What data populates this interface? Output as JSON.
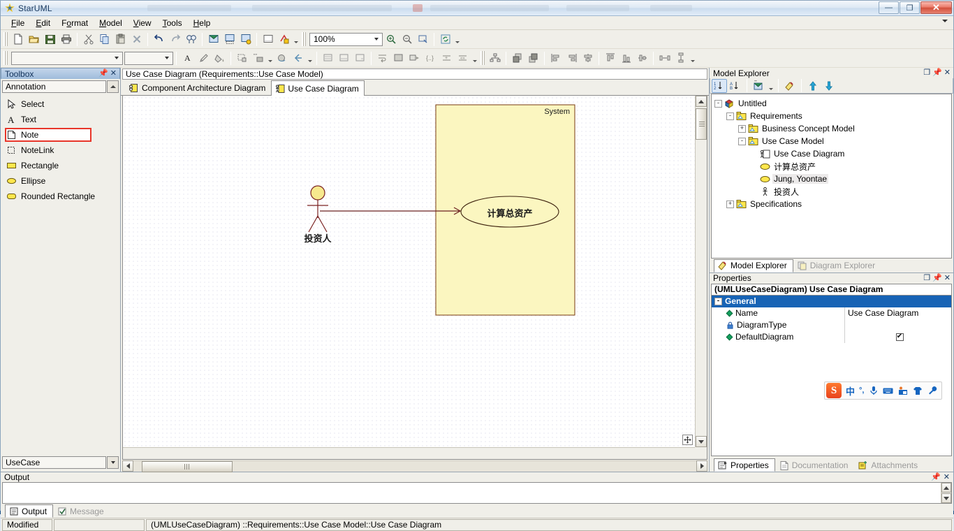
{
  "window": {
    "title": "StarUML",
    "app_icon": "star-icon",
    "minimize_label": "—",
    "maximize_label": "❐",
    "close_label": "✕"
  },
  "menubar": {
    "items": [
      {
        "label": "File",
        "mnemonic": "F"
      },
      {
        "label": "Edit",
        "mnemonic": "E"
      },
      {
        "label": "Format",
        "mnemonic": "o"
      },
      {
        "label": "Model",
        "mnemonic": "M"
      },
      {
        "label": "View",
        "mnemonic": "V"
      },
      {
        "label": "Tools",
        "mnemonic": "T"
      },
      {
        "label": "Help",
        "mnemonic": "H"
      }
    ],
    "overflow_icon": "chevron-down-icon"
  },
  "toolbar_main": {
    "zoom_value": "100%",
    "groups": [
      {
        "name": "file",
        "buttons": [
          "new-file-icon",
          "open-folder-icon",
          "save-icon",
          "print-icon"
        ]
      },
      {
        "name": "clipboard",
        "buttons": [
          "cut-icon",
          "copy-icon",
          "paste-icon",
          "delete-icon"
        ]
      },
      {
        "name": "history",
        "buttons": [
          "undo-icon",
          "redo-icon",
          "find-icon"
        ]
      },
      {
        "name": "diagram",
        "buttons": [
          "add-diagram-icon",
          "add-subdiagram-icon",
          "diagram-props-icon"
        ]
      },
      {
        "name": "generate",
        "buttons": [
          "generate-doc-icon",
          "validate-icon"
        ]
      },
      {
        "name": "zoom",
        "buttons": [
          "zoom-in-icon",
          "zoom-out-icon",
          "fit-window-icon"
        ]
      },
      {
        "name": "refresh",
        "buttons": [
          "refresh-icon"
        ]
      }
    ]
  },
  "toolbar_format": {
    "font_family_value": "",
    "font_size_value": "",
    "buttons": [
      "font-color-icon",
      "line-color-icon",
      "fill-color-icon",
      "stereotype-display-icon",
      "name-compartment-icon",
      "shadow-icon",
      "auto-resize-icon",
      "suppress-attributes-icon",
      "suppress-operations-icon",
      "suppress-literals-icon",
      "word-wrap-icon",
      "show-compartment-icon",
      "show-property-icon",
      "show-multiplicity-icon",
      "show-visibility-icon",
      "show-signature-icon",
      "layout-diagram-icon",
      "bring-to-front-icon",
      "send-to-back-icon",
      "align-left-icon",
      "align-center-icon",
      "align-right-icon",
      "align-top-icon",
      "align-middle-icon",
      "align-bottom-icon",
      "space-horizontally-icon",
      "space-vertically-icon"
    ]
  },
  "toolbox": {
    "title": "Toolbox",
    "pin_icon": "pin-icon",
    "close_icon": "close-icon",
    "group_label": "Annotation",
    "scroll_up_icon": "scroll-up-icon",
    "selected_item": "Note",
    "items": [
      {
        "label": "Select",
        "icon": "cursor-arrow-icon",
        "selected": false
      },
      {
        "label": "Text",
        "icon": "text-a-icon",
        "selected": false
      },
      {
        "label": "Note",
        "icon": "note-icon",
        "selected": true
      },
      {
        "label": "NoteLink",
        "icon": "note-link-icon",
        "selected": false
      },
      {
        "label": "Rectangle",
        "icon": "rectangle-icon",
        "selected": false
      },
      {
        "label": "Ellipse",
        "icon": "ellipse-icon",
        "selected": false
      },
      {
        "label": "Rounded Rectangle",
        "icon": "rounded-rectangle-icon",
        "selected": false
      }
    ],
    "bottom_group_label": "UseCase",
    "scroll_down_icon": "scroll-down-icon",
    "highlight_color": "#e8362a"
  },
  "editor": {
    "path": "Use Case Diagram (Requirements::Use Case Model)",
    "tabs": [
      {
        "label": "Component Architecture Diagram",
        "icon": "component-diagram-icon",
        "active": false
      },
      {
        "label": "Use Case Diagram",
        "icon": "usecase-diagram-icon",
        "active": true
      }
    ]
  },
  "diagram": {
    "type": "usecase",
    "boundary": {
      "label": "System",
      "fill": "#fbf6c0",
      "stroke": "#7a3b10"
    },
    "actor": {
      "label": "投资人",
      "head_fill": "#f7e98e",
      "stroke": "#7a2222"
    },
    "usecase": {
      "label": "计算总资产",
      "stroke": "#3b1f0b"
    },
    "association": {
      "from": "投资人",
      "to": "计算总资产",
      "stroke": "#6b2020"
    },
    "pan_icon": "pan-move-icon"
  },
  "model_explorer": {
    "title": "Model Explorer",
    "restore_icon": "restore-icon",
    "pin_icon": "pin-icon",
    "close_icon": "close-icon",
    "toolbar": [
      {
        "icon": "sort-numeric-icon",
        "active": true
      },
      {
        "icon": "sort-alpha-icon",
        "active": false
      },
      {
        "icon": "filter-diagram-icon",
        "active": false
      },
      {
        "icon": "select-in-explorer-icon",
        "active": false
      },
      {
        "icon": "move-up-icon",
        "active": false
      },
      {
        "icon": "move-down-icon",
        "active": false
      }
    ],
    "tree": [
      {
        "label": "Untitled",
        "depth": 0,
        "toggle": "-",
        "icon": "project-icon"
      },
      {
        "label": "Requirements",
        "depth": 1,
        "toggle": "-",
        "icon": "package-icon"
      },
      {
        "label": "Business Concept Model",
        "depth": 2,
        "toggle": "+",
        "icon": "package-icon"
      },
      {
        "label": "Use Case Model",
        "depth": 2,
        "toggle": "-",
        "icon": "package-icon"
      },
      {
        "label": "Use Case Diagram",
        "depth": 3,
        "toggle": "",
        "icon": "usecase-diagram-icon"
      },
      {
        "label": "计算总资产",
        "depth": 3,
        "toggle": "",
        "icon": "usecase-icon"
      },
      {
        "label": "Jung, Yoontae",
        "depth": 3,
        "toggle": "",
        "icon": "usecase-icon",
        "highlighted": true
      },
      {
        "label": "投资人",
        "depth": 3,
        "toggle": "",
        "icon": "actor-icon"
      },
      {
        "label": "Specifications",
        "depth": 1,
        "toggle": "+",
        "icon": "package-icon"
      }
    ],
    "tabs": [
      {
        "label": "Model Explorer",
        "icon": "model-explorer-icon",
        "active": true
      },
      {
        "label": "Diagram Explorer",
        "icon": "diagram-explorer-icon",
        "active": false
      }
    ]
  },
  "properties": {
    "title": "Properties",
    "restore_icon": "restore-icon",
    "pin_icon": "pin-icon",
    "close_icon": "close-icon",
    "subject": "(UMLUseCaseDiagram) Use Case Diagram",
    "section_label": "General",
    "section_toggle": "-",
    "header_color": "#1763b5",
    "rows": [
      {
        "name": "Name",
        "value": "Use Case Diagram",
        "icon": "diamond-icon",
        "type": "text"
      },
      {
        "name": "DiagramType",
        "value": "",
        "icon": "lock-icon",
        "type": "text"
      },
      {
        "name": "DefaultDiagram",
        "value": "✔",
        "icon": "diamond-icon",
        "type": "checkbox",
        "checked": true
      }
    ],
    "tabs": [
      {
        "label": "Properties",
        "icon": "properties-icon",
        "active": true
      },
      {
        "label": "Documentation",
        "icon": "documentation-icon",
        "active": false
      },
      {
        "label": "Attachments",
        "icon": "attachments-icon",
        "active": false
      }
    ]
  },
  "output": {
    "title": "Output",
    "pin_icon": "pin-icon",
    "close_icon": "close-icon",
    "content": "",
    "tabs": [
      {
        "label": "Output",
        "icon": "output-icon",
        "active": true
      },
      {
        "label": "Message",
        "icon": "message-icon",
        "active": false
      }
    ]
  },
  "statusbar": {
    "modified_label": "Modified",
    "secondary_label": "",
    "path_label": "(UMLUseCaseDiagram) ::Requirements::Use Case Model::Use Case Diagram"
  },
  "ime": {
    "name": "sogou-ime",
    "logo": "S",
    "mode_label": "中",
    "punct_label": "°,",
    "buttons": [
      "mic-icon",
      "keyboard-icon",
      "toolbox-icon",
      "skin-icon",
      "settings-icon"
    ]
  }
}
